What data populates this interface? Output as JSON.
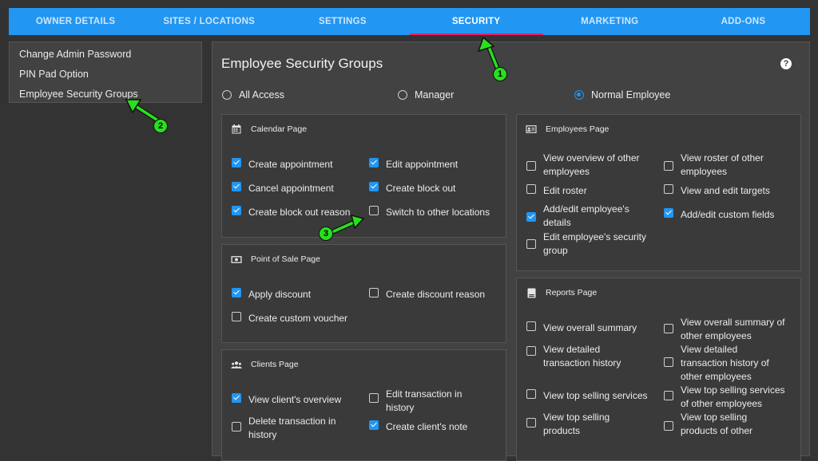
{
  "nav": {
    "tabs": [
      {
        "label": "OWNER DETAILS"
      },
      {
        "label": "SITES / LOCATIONS"
      },
      {
        "label": "SETTINGS"
      },
      {
        "label": "SECURITY"
      },
      {
        "label": "MARKETING"
      },
      {
        "label": "ADD-ONS"
      }
    ],
    "active_tab": "SECURITY"
  },
  "sidebar": {
    "items": [
      {
        "label": "Change Admin Password"
      },
      {
        "label": "PIN Pad Option"
      },
      {
        "label": "Employee Security Groups"
      }
    ]
  },
  "main": {
    "title": "Employee Security Groups",
    "help": "?",
    "access_options": [
      {
        "label": "All Access",
        "selected": false
      },
      {
        "label": "Manager",
        "selected": false
      },
      {
        "label": "Normal Employee",
        "selected": true
      }
    ],
    "sections": {
      "calendar": {
        "title": "Calendar Page",
        "items": [
          {
            "label": "Create appointment",
            "checked": true
          },
          {
            "label": "Edit appointment",
            "checked": true
          },
          {
            "label": "Cancel appointment",
            "checked": true
          },
          {
            "label": "Create block out",
            "checked": true
          },
          {
            "label": "Create block out reason",
            "checked": true
          },
          {
            "label": "Switch to other locations",
            "checked": false
          }
        ]
      },
      "pos": {
        "title": "Point of Sale Page",
        "items": [
          {
            "label": "Apply discount",
            "checked": true
          },
          {
            "label": "Create discount reason",
            "checked": false
          },
          {
            "label": "Create custom voucher",
            "checked": false
          }
        ]
      },
      "clients": {
        "title": "Clients Page",
        "items": [
          {
            "label": "View client's overview",
            "checked": true
          },
          {
            "label": "Edit transaction in history",
            "checked": false
          },
          {
            "label": "Delete transaction in history",
            "checked": false
          },
          {
            "label": "Create client's note",
            "checked": true
          }
        ]
      },
      "employees": {
        "title": "Employees Page",
        "items": [
          {
            "label": "View overview of other employees",
            "checked": false
          },
          {
            "label": "View roster of other employees",
            "checked": false
          },
          {
            "label": "Edit roster",
            "checked": false
          },
          {
            "label": "View and edit targets",
            "checked": false
          },
          {
            "label": "Add/edit employee's details",
            "checked": true
          },
          {
            "label": "Add/edit custom fields",
            "checked": true
          },
          {
            "label": "Edit employee's security group",
            "checked": false
          }
        ]
      },
      "reports": {
        "title": "Reports Page",
        "items": [
          {
            "label": "View overall summary",
            "checked": false
          },
          {
            "label": "View overall summary of other employees",
            "checked": false
          },
          {
            "label": "View detailed transaction history",
            "checked": false
          },
          {
            "label": "View detailed transaction history of other employees",
            "checked": false
          },
          {
            "label": "View top selling services",
            "checked": false
          },
          {
            "label": "View top selling services of other employees",
            "checked": false
          },
          {
            "label": "View top selling products",
            "checked": false
          },
          {
            "label": "View top selling products of other",
            "checked": false
          }
        ]
      }
    }
  },
  "annotations": [
    {
      "label": "1"
    },
    {
      "label": "2"
    },
    {
      "label": "3"
    }
  ],
  "colors": {
    "accent": "#2196f3",
    "active_tab_underline": "#e91e63",
    "annotation_green": "#28e01e"
  }
}
